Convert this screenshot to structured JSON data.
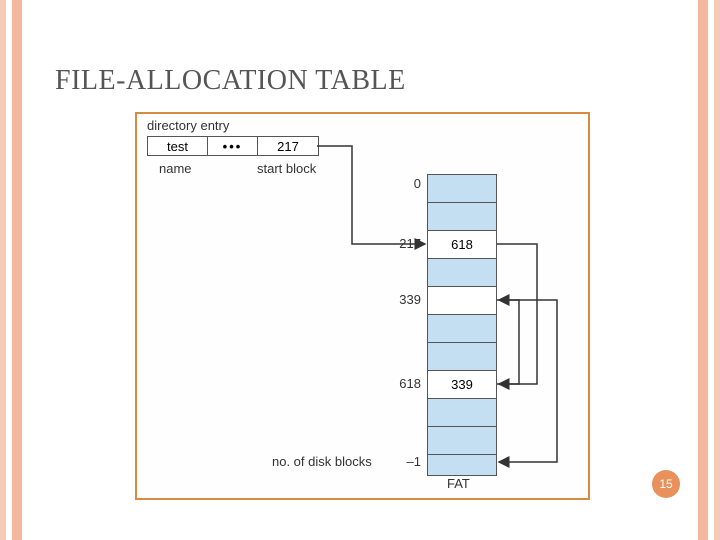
{
  "title": "FILE-ALLOCATION TABLE",
  "dir": {
    "label": "directory entry",
    "name_cell": "test",
    "dots": "•••",
    "startblock_cell": "217",
    "name_sub": "name",
    "startblock_sub": "start block"
  },
  "fat": {
    "indices": {
      "i0": "0",
      "i217": "217",
      "i339": "339",
      "i618": "618",
      "iend": "–1"
    },
    "values": {
      "v217": "618",
      "v618": "339"
    },
    "bottom_label": "no. of disk blocks",
    "caption": "FAT"
  },
  "pagenum": "15"
}
